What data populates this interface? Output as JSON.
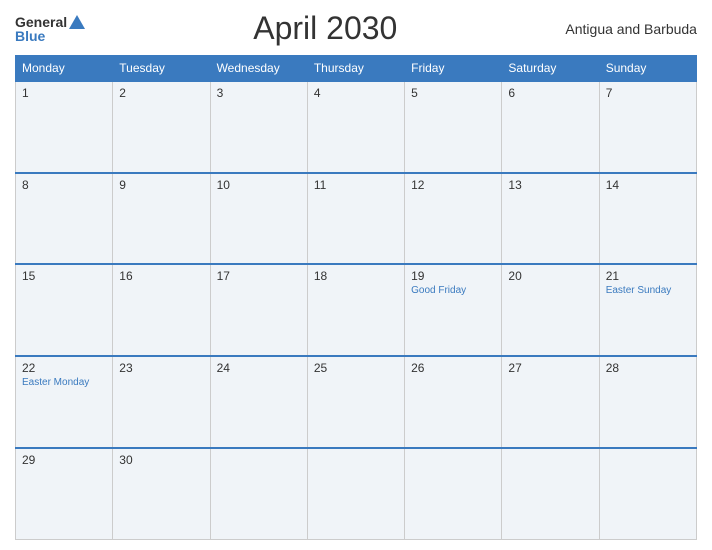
{
  "header": {
    "logo_general": "General",
    "logo_blue": "Blue",
    "title": "April 2030",
    "country": "Antigua and Barbuda"
  },
  "calendar": {
    "weekdays": [
      "Monday",
      "Tuesday",
      "Wednesday",
      "Thursday",
      "Friday",
      "Saturday",
      "Sunday"
    ],
    "rows": [
      [
        {
          "day": "1",
          "holiday": ""
        },
        {
          "day": "2",
          "holiday": ""
        },
        {
          "day": "3",
          "holiday": ""
        },
        {
          "day": "4",
          "holiday": ""
        },
        {
          "day": "5",
          "holiday": ""
        },
        {
          "day": "6",
          "holiday": ""
        },
        {
          "day": "7",
          "holiday": ""
        }
      ],
      [
        {
          "day": "8",
          "holiday": ""
        },
        {
          "day": "9",
          "holiday": ""
        },
        {
          "day": "10",
          "holiday": ""
        },
        {
          "day": "11",
          "holiday": ""
        },
        {
          "day": "12",
          "holiday": ""
        },
        {
          "day": "13",
          "holiday": ""
        },
        {
          "day": "14",
          "holiday": ""
        }
      ],
      [
        {
          "day": "15",
          "holiday": ""
        },
        {
          "day": "16",
          "holiday": ""
        },
        {
          "day": "17",
          "holiday": ""
        },
        {
          "day": "18",
          "holiday": ""
        },
        {
          "day": "19",
          "holiday": "Good Friday"
        },
        {
          "day": "20",
          "holiday": ""
        },
        {
          "day": "21",
          "holiday": "Easter Sunday"
        }
      ],
      [
        {
          "day": "22",
          "holiday": "Easter Monday"
        },
        {
          "day": "23",
          "holiday": ""
        },
        {
          "day": "24",
          "holiday": ""
        },
        {
          "day": "25",
          "holiday": ""
        },
        {
          "day": "26",
          "holiday": ""
        },
        {
          "day": "27",
          "holiday": ""
        },
        {
          "day": "28",
          "holiday": ""
        }
      ],
      [
        {
          "day": "29",
          "holiday": ""
        },
        {
          "day": "30",
          "holiday": ""
        },
        {
          "day": "",
          "holiday": ""
        },
        {
          "day": "",
          "holiday": ""
        },
        {
          "day": "",
          "holiday": ""
        },
        {
          "day": "",
          "holiday": ""
        },
        {
          "day": "",
          "holiday": ""
        }
      ]
    ]
  }
}
